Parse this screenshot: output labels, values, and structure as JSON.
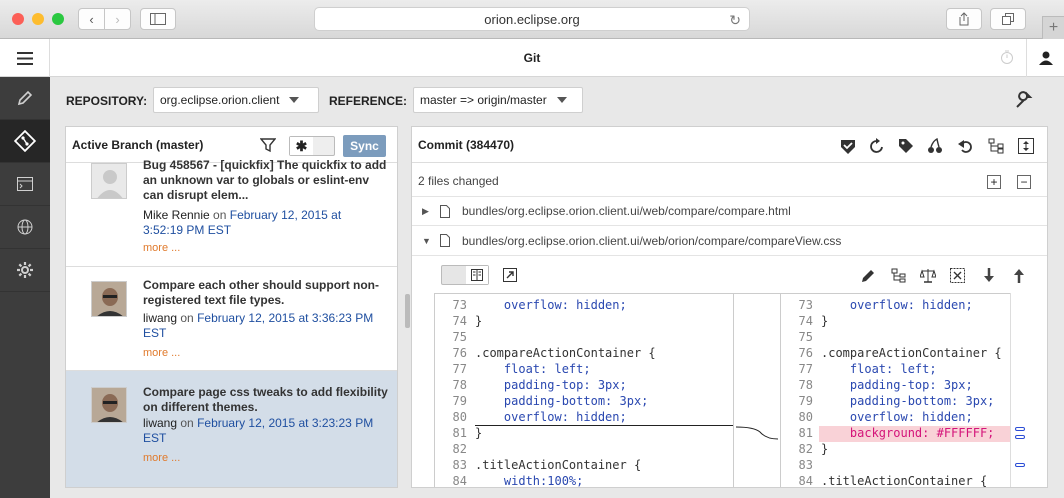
{
  "browser": {
    "url": "orion.eclipse.org",
    "back": "‹",
    "forward": "›"
  },
  "app": {
    "title": "Git"
  },
  "repo_bar": {
    "repository_label": "REPOSITORY:",
    "repository_value": "org.eclipse.orion.client",
    "reference_label": "REFERENCE:",
    "reference_value": "master => origin/master"
  },
  "left_panel": {
    "title": "Active Branch (master)",
    "sync_label": "Sync",
    "commits": [
      {
        "title": "Bug 458567 - [quickfix] The quickfix to add an unknown var to globals or eslint-env can disrupt elem...",
        "author": "Mike Rennie",
        "on": "on",
        "date": "February 12, 2015 at 3:52:19 PM EST",
        "more": "more ..."
      },
      {
        "title": "Compare each other should support non-registered text file types.",
        "author": "liwang",
        "on": "on",
        "date": "February 12, 2015 at 3:36:23 PM EST",
        "more": "more ..."
      },
      {
        "title": "Compare page css tweaks to add flexibility on different themes.",
        "author": "liwang",
        "on": "on",
        "date": "February 12, 2015 at 3:23:23 PM EST",
        "more": "more ..."
      }
    ]
  },
  "right_panel": {
    "title": "Commit (384470)",
    "files_changed": "2 files changed",
    "files": [
      {
        "path": "bundles/org.eclipse.orion.client.ui/web/compare/compare.html"
      },
      {
        "path": "bundles/org.eclipse.orion.client.ui/web/orion/compare/compareView.css"
      }
    ]
  },
  "diff": {
    "left": [
      {
        "n": "73",
        "t": "    overflow: hidden;"
      },
      {
        "n": "74",
        "t": "}"
      },
      {
        "n": "75",
        "t": ""
      },
      {
        "n": "76",
        "t": ".compareActionContainer {"
      },
      {
        "n": "77",
        "t": "    float: left;"
      },
      {
        "n": "78",
        "t": "    padding-top: 3px;"
      },
      {
        "n": "79",
        "t": "    padding-bottom: 3px;"
      },
      {
        "n": "80",
        "t": "    overflow: hidden;"
      },
      {
        "n": "81",
        "t": "}"
      },
      {
        "n": "82",
        "t": ""
      },
      {
        "n": "83",
        "t": ".titleActionContainer {"
      },
      {
        "n": "84",
        "t": "    width:100%;"
      }
    ],
    "right": [
      {
        "n": "73",
        "t": "    overflow: hidden;"
      },
      {
        "n": "74",
        "t": "}"
      },
      {
        "n": "75",
        "t": ""
      },
      {
        "n": "76",
        "t": ".compareActionContainer {"
      },
      {
        "n": "77",
        "t": "    float: left;"
      },
      {
        "n": "78",
        "t": "    padding-top: 3px;"
      },
      {
        "n": "79",
        "t": "    padding-bottom: 3px;"
      },
      {
        "n": "80",
        "t": "    overflow: hidden;"
      },
      {
        "n": "81",
        "t": "    background: #FFFFFF;"
      },
      {
        "n": "82",
        "t": "}"
      },
      {
        "n": "83",
        "t": ""
      },
      {
        "n": "84",
        "t": ".titleActionContainer {"
      }
    ]
  },
  "colors": {
    "sidebar": "#3d3d3d",
    "sync": "#7c9cbd",
    "selected_row": "#d3dde8",
    "added_line": "#f9d2d7",
    "date": "#1f4fa0",
    "more": "#e07a2c"
  }
}
